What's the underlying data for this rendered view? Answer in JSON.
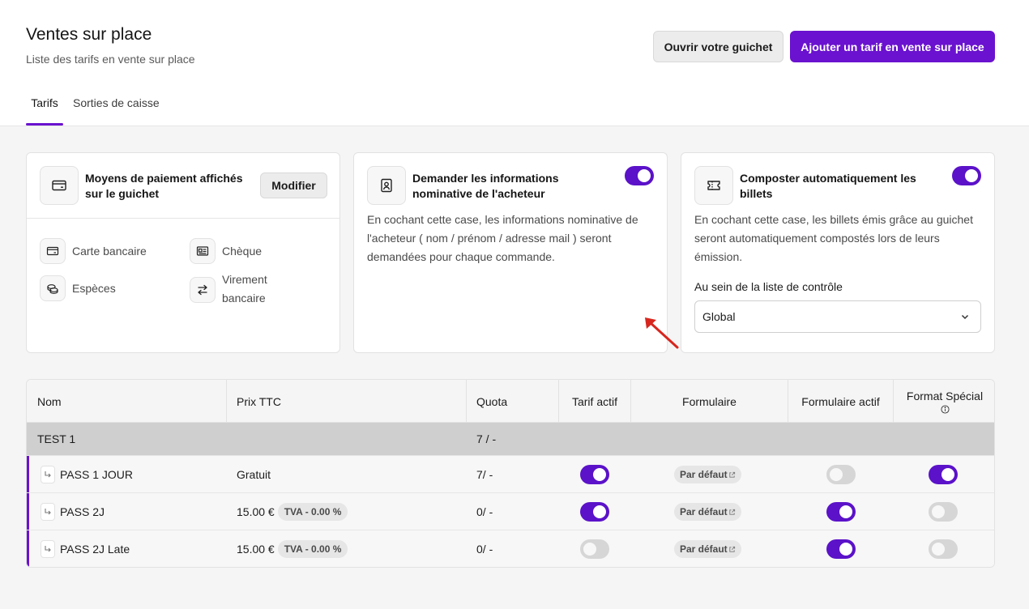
{
  "header": {
    "title": "Ventes sur place",
    "subtitle": "Liste des tarifs en vente sur place",
    "open_button": "Ouvrir votre guichet",
    "add_button": "Ajouter un tarif en vente sur place",
    "accent_color": "#6a12cf"
  },
  "tabs": [
    {
      "label": "Tarifs",
      "active": true
    },
    {
      "label": "Sorties de caisse",
      "active": false
    }
  ],
  "payment_card": {
    "title": "Moyens de paiement affichés sur le guichet",
    "modify_button": "Modifier",
    "icon": "credit-card-icon",
    "methods": [
      {
        "label": "Carte bancaire",
        "icon": "credit-card-icon"
      },
      {
        "label": "Chèque",
        "icon": "cheque-icon"
      },
      {
        "label": "Espèces",
        "icon": "coins-icon"
      },
      {
        "label": "Virement bancaire",
        "icon": "transfer-icon"
      }
    ]
  },
  "buyer_info_card": {
    "title": "Demander les informations nominative de l'acheteur",
    "description": "En cochant cette case, les informations nominative de l'acheteur ( nom / prénom / adresse mail ) seront demandées pour chaque commande.",
    "enabled": true,
    "icon": "id-badge-icon"
  },
  "auto_compost_card": {
    "title": "Composter automatiquement les billets",
    "description": "En cochant cette case, les billets émis grâce au guichet seront automatiquement compostés lors de leurs émission.",
    "enabled": true,
    "icon": "ticket-icon",
    "select_label": "Au sein de la liste de contrôle",
    "select_value": "Global"
  },
  "table": {
    "columns": [
      "Nom",
      "Prix TTC",
      "Quota",
      "Tarif actif",
      "Formulaire",
      "Formulaire actif",
      "Format Spécial"
    ],
    "group": {
      "name": "TEST 1",
      "quota": "7 / -"
    },
    "rows": [
      {
        "name": "PASS 1 JOUR",
        "price": "Gratuit",
        "tva": "",
        "quota": "7/ -",
        "tarif_actif": true,
        "formulaire": "Par défaut",
        "formulaire_actif": false,
        "format_special": true
      },
      {
        "name": "PASS 2J",
        "price": "15.00 €",
        "tva": "TVA - 0.00 %",
        "quota": "0/ -",
        "tarif_actif": true,
        "formulaire": "Par défaut",
        "formulaire_actif": true,
        "format_special": false
      },
      {
        "name": "PASS 2J Late",
        "price": "15.00 €",
        "tva": "TVA - 0.00 %",
        "quota": "0/ -",
        "tarif_actif": false,
        "formulaire": "Par défaut",
        "formulaire_actif": true,
        "format_special": false
      }
    ]
  }
}
